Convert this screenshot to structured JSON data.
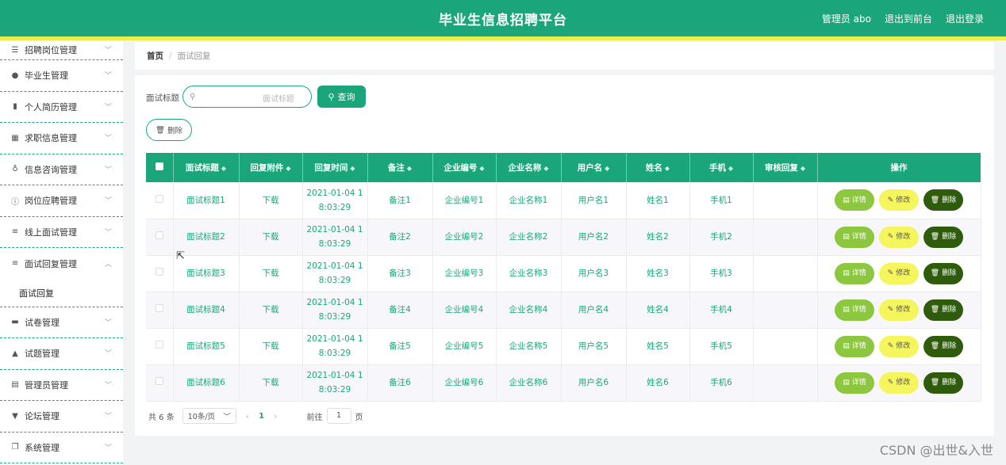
{
  "header": {
    "title": "毕业生信息招聘平台",
    "admin": "管理员 abo",
    "to_front": "退出到前台",
    "logout": "退出登录"
  },
  "sidebar": {
    "items": [
      {
        "label": "招聘岗位管理",
        "icon": "sliders-icon"
      },
      {
        "label": "毕业生管理",
        "icon": "microphone-icon"
      },
      {
        "label": "个人简历管理",
        "icon": "bar-chart-icon"
      },
      {
        "label": "求职信息管理",
        "icon": "grid-icon"
      },
      {
        "label": "信息咨询管理",
        "icon": "mic-icon"
      },
      {
        "label": "岗位应聘管理",
        "icon": "info-icon"
      },
      {
        "label": "线上面试管理",
        "icon": "list-icon"
      },
      {
        "label": "面试回复管理",
        "icon": "list-icon"
      },
      {
        "label": "试卷管理",
        "icon": "monitor-icon"
      },
      {
        "label": "试题管理",
        "icon": "user-icon"
      },
      {
        "label": "管理员管理",
        "icon": "clipboard-icon"
      },
      {
        "label": "论坛管理",
        "icon": "pin-icon"
      },
      {
        "label": "系统管理",
        "icon": "copy-icon"
      }
    ],
    "sub_active": "面试回复"
  },
  "breadcrumb": {
    "home": "首页",
    "sep": "/",
    "current": "面试回复"
  },
  "search": {
    "label": "面试标题",
    "placeholder": "面试标题",
    "button": "查询"
  },
  "delete_button": "删除",
  "table": {
    "headers": [
      "面试标题",
      "回复附件",
      "回复时间",
      "备注",
      "企业编号",
      "企业名称",
      "用户名",
      "姓名",
      "手机",
      "审核回复",
      "操作"
    ],
    "rows": [
      {
        "title": "面试标题1",
        "file": "下载",
        "time1": "2021-01-04 1",
        "time2": "8:03:29",
        "note": "备注1",
        "cid": "企业编号1",
        "cname": "企业名称1",
        "user": "用户名1",
        "name": "姓名1",
        "phone": "手机1",
        "review": ""
      },
      {
        "title": "面试标题2",
        "file": "下载",
        "time1": "2021-01-04 1",
        "time2": "8:03:29",
        "note": "备注2",
        "cid": "企业编号2",
        "cname": "企业名称2",
        "user": "用户名2",
        "name": "姓名2",
        "phone": "手机2",
        "review": ""
      },
      {
        "title": "面试标题3",
        "file": "下载",
        "time1": "2021-01-04 1",
        "time2": "8:03:29",
        "note": "备注3",
        "cid": "企业编号3",
        "cname": "企业名称3",
        "user": "用户名3",
        "name": "姓名3",
        "phone": "手机3",
        "review": ""
      },
      {
        "title": "面试标题4",
        "file": "下载",
        "time1": "2021-01-04 1",
        "time2": "8:03:29",
        "note": "备注4",
        "cid": "企业编号4",
        "cname": "企业名称4",
        "user": "用户名4",
        "name": "姓名4",
        "phone": "手机4",
        "review": ""
      },
      {
        "title": "面试标题5",
        "file": "下载",
        "time1": "2021-01-04 1",
        "time2": "8:03:29",
        "note": "备注5",
        "cid": "企业编号5",
        "cname": "企业名称5",
        "user": "用户名5",
        "name": "姓名5",
        "phone": "手机5",
        "review": ""
      },
      {
        "title": "面试标题6",
        "file": "下载",
        "time1": "2021-01-04 1",
        "time2": "8:03:29",
        "note": "备注6",
        "cid": "企业编号6",
        "cname": "企业名称6",
        "user": "用户名6",
        "name": "姓名6",
        "phone": "手机6",
        "review": ""
      }
    ],
    "actions": {
      "detail": "详情",
      "edit": "修改",
      "delete": "删除"
    }
  },
  "pager": {
    "total": "共 6 条",
    "page_size": "10条/页",
    "current_page": "1",
    "goto_label": "前往",
    "goto_value": "1",
    "page_unit": "页"
  },
  "watermark": "CSDN @出世&入世",
  "colors": {
    "primary": "#1aa67a",
    "stripe": "#e9ef4a",
    "detail": "#8dc63f",
    "edit": "#f5f55e",
    "delete": "#2f5c0c"
  }
}
